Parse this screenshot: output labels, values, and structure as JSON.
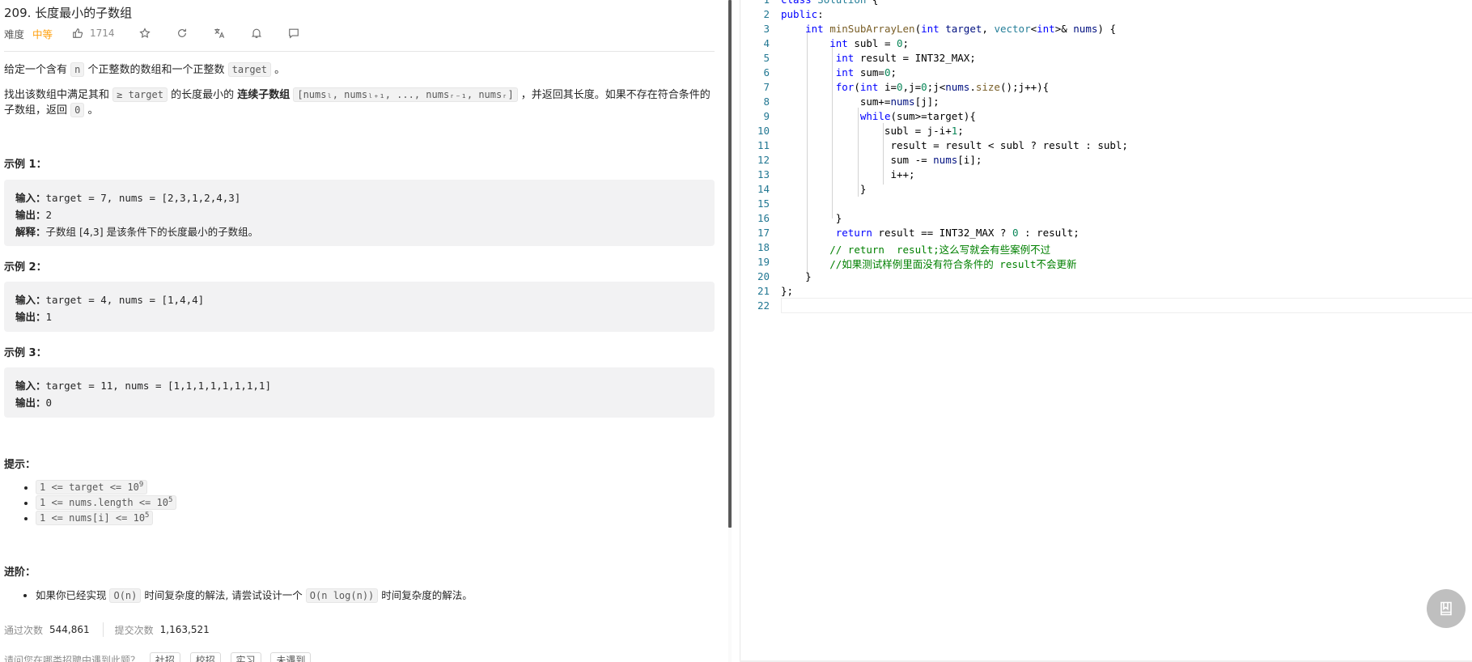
{
  "problem": {
    "title": "209. 长度最小的子数组",
    "difficulty_label": "难度",
    "difficulty": "中等",
    "likes": "1714",
    "desc1_a": "给定一个含有 ",
    "desc1_n": "n",
    "desc1_b": " 个正整数的数组和一个正整数 ",
    "desc1_target": "target",
    "desc1_c": " 。",
    "desc2_a": "找出该数组中满足其和 ",
    "desc2_ge": "≥ target",
    "desc2_b": " 的长度最小的 ",
    "desc2_bold": "连续子数组",
    "desc2_code": "[numsₗ, numsₗ₊₁, ..., numsᵣ₋₁, numsᵣ]",
    "desc2_c": " ，并返回其长度。如果不存在符合条件的",
    "desc2_d": "子数组，返回 ",
    "desc2_zero": "0",
    "desc2_e": " 。",
    "examples": [
      {
        "heading": "示例 1：",
        "input_label": "输入：",
        "input": "target = 7, nums = [2,3,1,2,4,3]",
        "output_label": "输出：",
        "output": "2",
        "explain_label": "解释：",
        "explain": "子数组 [4,3] 是该条件下的长度最小的子数组。"
      },
      {
        "heading": "示例 2：",
        "input_label": "输入：",
        "input": "target = 4, nums = [1,4,4]",
        "output_label": "输出：",
        "output": "1"
      },
      {
        "heading": "示例 3：",
        "input_label": "输入：",
        "input": "target = 11, nums = [1,1,1,1,1,1,1,1]",
        "output_label": "输出：",
        "output": "0"
      }
    ],
    "hints_heading": "提示：",
    "hints": [
      {
        "base": "1 <= target <= 10",
        "sup": "9"
      },
      {
        "base": "1 <= nums.length <= 10",
        "sup": "5"
      },
      {
        "base": "1 <= nums[i] <= 10",
        "sup": "5"
      }
    ],
    "advanced_heading": "进阶：",
    "advanced_a": "如果你已经实现 ",
    "advanced_code1": "O(n)",
    "advanced_b": " 时间复杂度的解法, 请尝试设计一个 ",
    "advanced_code2": "O(n log(n))",
    "advanced_c": " 时间复杂度的解法。",
    "accepted_label": "通过次数",
    "accepted": "544,861",
    "submissions_label": "提交次数",
    "submissions": "1,163,521",
    "survey_text": "请问您在哪类招聘中遇到此题？",
    "survey_tags": [
      "社招",
      "校招",
      "实习",
      "未遇到"
    ]
  },
  "editor": {
    "line_numbers": [
      "1",
      "2",
      "3",
      "4",
      "5",
      "6",
      "7",
      "8",
      "9",
      "10",
      "11",
      "12",
      "13",
      "14",
      "15",
      "16",
      "17",
      "18",
      "19",
      "20",
      "21",
      "22"
    ]
  },
  "icons": [
    "thumbs-up-icon",
    "star-icon",
    "refresh-icon",
    "translate-icon",
    "bell-icon",
    "comment-icon",
    "bookmark-icon"
  ]
}
